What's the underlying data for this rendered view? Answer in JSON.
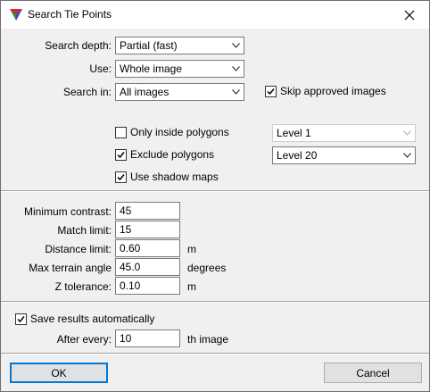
{
  "window": {
    "title": "Search Tie Points"
  },
  "search": {
    "depth_label": "Search depth:",
    "depth_value": "Partial (fast)",
    "use_label": "Use:",
    "use_value": "Whole image",
    "search_in_label": "Search in:",
    "search_in_value": "All images",
    "skip_approved_label": "Skip approved images",
    "skip_approved_checked": true
  },
  "polygons": {
    "only_inside_label": "Only inside polygons",
    "only_inside_checked": false,
    "only_inside_level": "Level 1",
    "exclude_label": "Exclude polygons",
    "exclude_checked": true,
    "exclude_level": "Level 20",
    "shadow_maps_label": "Use shadow maps",
    "shadow_maps_checked": true
  },
  "params": {
    "min_contrast_label": "Minimum contrast:",
    "min_contrast_value": "45",
    "match_limit_label": "Match limit:",
    "match_limit_value": "15",
    "distance_limit_label": "Distance limit:",
    "distance_limit_value": "0.60",
    "distance_limit_unit": "m",
    "max_terrain_angle_label": "Max terrain angle",
    "max_terrain_angle_value": "45.0",
    "max_terrain_angle_unit": "degrees",
    "z_tolerance_label": "Z tolerance:",
    "z_tolerance_value": "0.10",
    "z_tolerance_unit": "m"
  },
  "save": {
    "auto_label": "Save results automatically",
    "auto_checked": true,
    "after_every_label": "After every:",
    "after_every_value": "10",
    "after_every_unit": "th image"
  },
  "buttons": {
    "ok_label": "OK",
    "cancel_label": "Cancel"
  }
}
